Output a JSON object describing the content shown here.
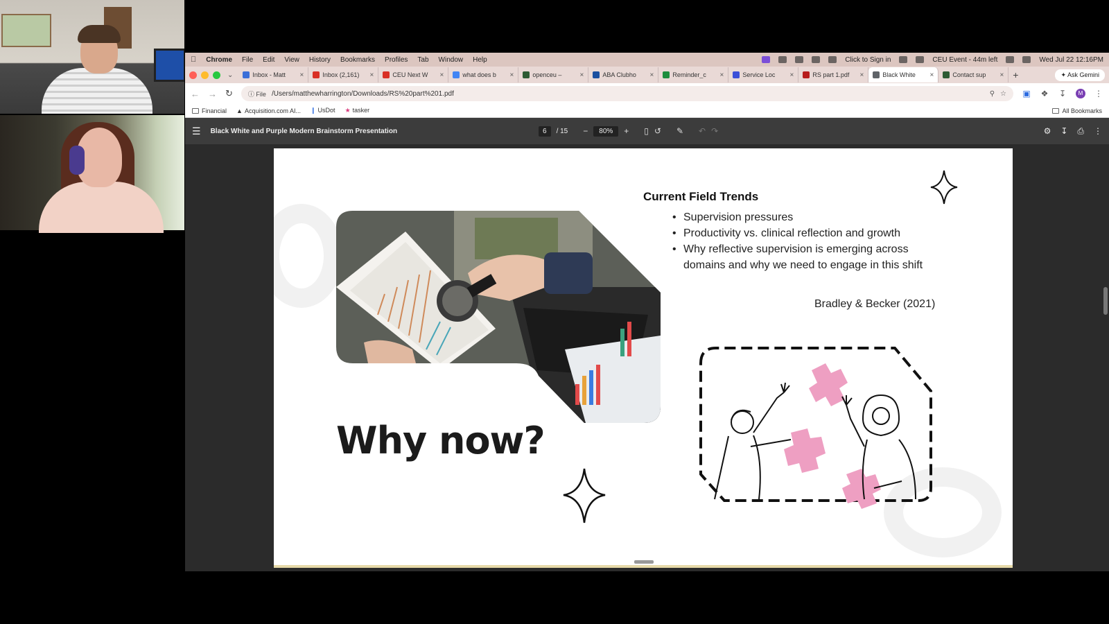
{
  "menubar": {
    "app": "Chrome",
    "items": [
      "File",
      "Edit",
      "View",
      "History",
      "Bookmarks",
      "Profiles",
      "Tab",
      "Window",
      "Help"
    ],
    "signin": "Click to Sign in",
    "event": "CEU Event - 44m left",
    "datetime": "Wed Jul 22 12:16PM"
  },
  "tabs": [
    {
      "label": "Inbox - Matt",
      "color": "#3b6fd8"
    },
    {
      "label": "Inbox (2,161)",
      "color": "#d93025"
    },
    {
      "label": "CEU Next W",
      "color": "#d93025"
    },
    {
      "label": "what does b",
      "color": "#4285f4"
    },
    {
      "label": "openceu – ",
      "color": "#2e5c34"
    },
    {
      "label": "ABA Clubho",
      "color": "#1a4fa0"
    },
    {
      "label": "Reminder_c",
      "color": "#1e8e3e"
    },
    {
      "label": "Service Loc",
      "color": "#3b4fd8"
    },
    {
      "label": "RS part 1.pdf",
      "color": "#b71c1c"
    },
    {
      "label": "Black White",
      "color": "#5f6368"
    },
    {
      "label": "Contact sup",
      "color": "#2e5c34"
    }
  ],
  "gemini": "Ask Gemini",
  "address": {
    "scheme": "File",
    "url": "/Users/matthewharrington/Downloads/RS%20part%201.pdf"
  },
  "bookmarks": [
    "Financial",
    "Acquisition.com AI...",
    "UsDot",
    "tasker"
  ],
  "all_bookmarks": "All Bookmarks",
  "pdf": {
    "title": "Black White and Purple Modern Brainstorm Presentation",
    "page": "6",
    "total": "/ 15",
    "zoom": "80%"
  },
  "slide": {
    "heading": "Why now?",
    "section_title": "Current Field Trends",
    "bullets": [
      "Supervision pressures",
      "Productivity vs. clinical reflection and growth",
      "Why reflective supervision is emerging across domains and why we need to engage in this shift"
    ],
    "citation": "Bradley & Becker (2021)"
  },
  "colors": {
    "accent_pink": "#ee9fc2",
    "slide_text": "#1b1b1b"
  }
}
